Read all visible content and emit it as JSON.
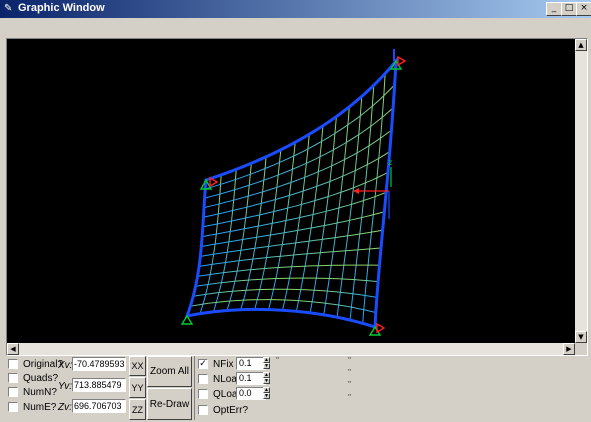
{
  "window": {
    "title": "Graphic Window",
    "app_icon": "pen-icon",
    "min_glyph": "_",
    "max_glyph": "□",
    "close_glyph": "×"
  },
  "colors": {
    "titlebar_start": "#0a246a",
    "titlebar_end": "#a6caf0",
    "canvas_bg": "#000000",
    "boundary": "#1a4cff",
    "mesh_top": "#8ed86a",
    "mesh_bottom": "#1ca0ff",
    "support": "#00cc33",
    "load": "#ff2020"
  },
  "options": [
    {
      "label": "Original?",
      "checked": false
    },
    {
      "label": "Quads?",
      "checked": false
    },
    {
      "label": "NumN?",
      "checked": false
    },
    {
      "label": "NumE?",
      "checked": false
    }
  ],
  "coords": {
    "xv_label": "Xv:",
    "xv_value": "-70.4789593",
    "yv_label": "Yv:",
    "yv_value": "713.885479",
    "zv_label": "Zv:",
    "zv_value": "696.706703"
  },
  "view_buttons": {
    "xx": "XX",
    "yy": "YY",
    "zz": "ZZ",
    "zoom_all": "Zoom All",
    "redraw": "Re-Draw"
  },
  "display_options": [
    {
      "label": "NFix",
      "checked": true,
      "value": "0.1"
    },
    {
      "label": "NLoad",
      "checked": false,
      "value": "0.1"
    },
    {
      "label": "QLoad",
      "checked": false,
      "value": "0.0"
    },
    {
      "label": "OptErr?",
      "checked": false
    }
  ]
}
